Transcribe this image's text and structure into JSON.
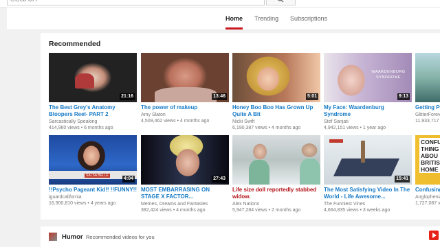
{
  "search": {
    "value": "search",
    "placeholder": "Search"
  },
  "tabs": [
    "Home",
    "Trending",
    "Subscriptions"
  ],
  "recommended": {
    "title": "Recommended",
    "rows": [
      [
        {
          "title": "The Best Grey's Anatomy Bloopers Reel- PART 2",
          "channel": "Sarcastically Speaking",
          "meta": "414,960 views • 6 months ago",
          "duration": "21:16",
          "red": false
        },
        {
          "title": "The power of makeup",
          "channel": "Amy Slaton",
          "meta": "4,509,462 views • 4 months ago",
          "duration": "13:46",
          "red": false
        },
        {
          "title": "Honey Boo Boo Has Grown Up Quite A Bit",
          "channel": "Nicki Swift",
          "meta": "6,190,387 views • 4 months ago",
          "duration": "5:01",
          "red": false
        },
        {
          "title": "My Face: Waardenburg Syndrome",
          "channel": "Stef Sanjati",
          "meta": "4,942,151 views • 1 year ago",
          "duration": "9:13",
          "red": false
        },
        {
          "title": "Getting Pe Before & A",
          "channel": "GlitterForev",
          "meta": "11,933,717",
          "duration": "",
          "red": false
        }
      ],
      [
        {
          "title": "!!Psycho Pageant Kid!! !!FUNNY!!",
          "channel": "iguardcalifornia",
          "meta": "16,900,810 views • 4 years ago",
          "duration": "4:04",
          "red": false
        },
        {
          "title": "MOST EMBARRASING ON STAGE X FACTOR...",
          "channel": "Memes, Dreams and Fantasies",
          "meta": "382,424 views • 4 months ago",
          "duration": "27:43",
          "red": false
        },
        {
          "title": "Life size doll reportedly stabbed widow.",
          "channel": "Alex Nations",
          "meta": "5,947,284 views • 2 months ago",
          "duration": "",
          "red": true
        },
        {
          "title": "The Most Satisfying Video In The World - Life Awesome...",
          "channel": "The Funniest Vines",
          "meta": "4,664,835 views • 3 weeks ago",
          "duration": "15:41",
          "red": false
        },
        {
          "title": "Confusing British Ho",
          "channel": "Anglophenia",
          "meta": "1,727,087 v",
          "duration": "",
          "red": false
        }
      ]
    ],
    "thumb_overlays": {
      "waardenburg": "WAARDENBURG SYNDROME",
      "pageant": "SALSA BELLE",
      "confusing": "CONFUS THING ABOU BRITIS HOME"
    }
  },
  "humor": {
    "title": "Humor",
    "subtitle": "Recommended videos for you"
  },
  "colors": {
    "link": "#167ac6",
    "accent": "#cc181e",
    "bg": "#f1f1f1"
  }
}
